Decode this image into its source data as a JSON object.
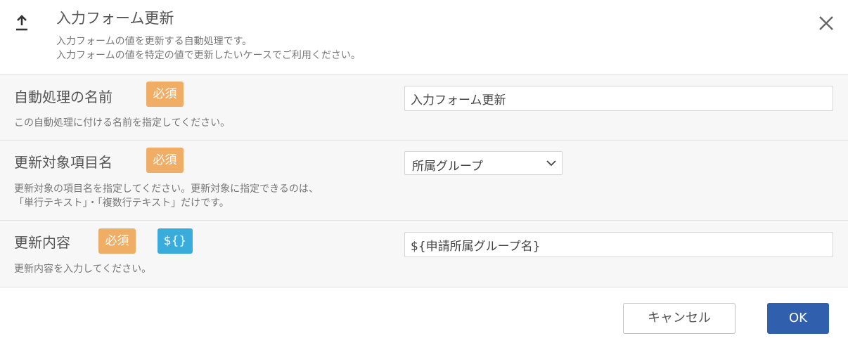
{
  "dialog": {
    "title": "入力フォーム更新",
    "description_line1": "入力フォームの値を更新する自動処理です。",
    "description_line2": "入力フォームの値を特定の値で更新したいケースでご利用ください。",
    "header_icon": "upload-arrow-icon",
    "close_icon": "close-icon"
  },
  "fields": {
    "name": {
      "label": "自動処理の名前",
      "required_badge": "必須",
      "help": "この自動処理に付ける名前を指定してください。",
      "value": "入力フォーム更新"
    },
    "target": {
      "label": "更新対象項目名",
      "required_badge": "必須",
      "help_line1": "更新対象の項目名を指定してください。更新対象に指定できるのは、",
      "help_line2": "「単行テキスト」・「複数行テキスト」だけです。",
      "selected": "所属グループ"
    },
    "content": {
      "label": "更新内容",
      "required_badge": "必須",
      "variable_badge": "${}",
      "help": "更新内容を入力してください。",
      "value": "${申請所属グループ名}"
    }
  },
  "buttons": {
    "cancel": "キャンセル",
    "ok": "OK"
  },
  "colors": {
    "required_badge": "#f0ad65",
    "variable_badge": "#3aacdc",
    "primary_button": "#2f5fad",
    "row_background": "#f7f7f7"
  }
}
